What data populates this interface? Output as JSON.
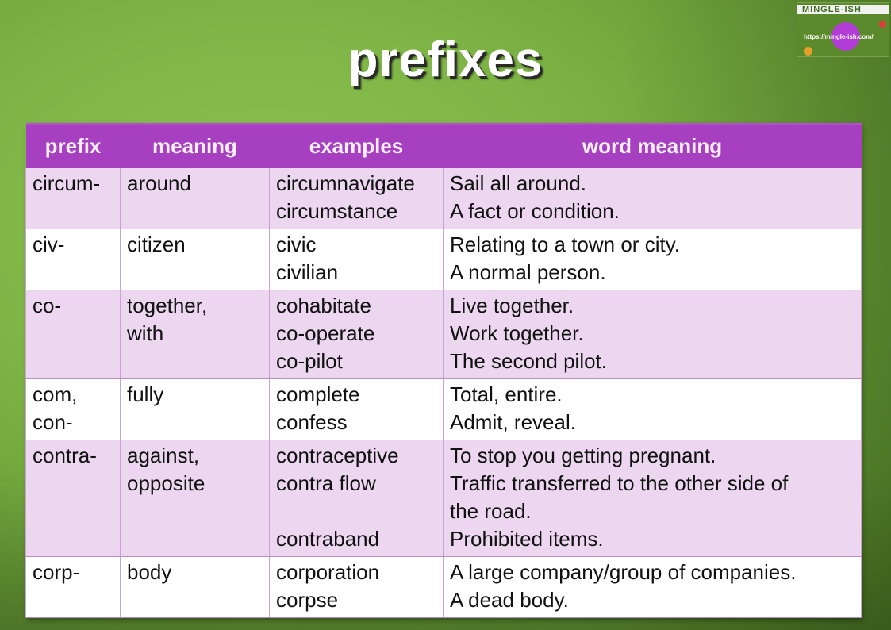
{
  "title": "prefixes",
  "logo": {
    "name": "MINGLE-ISH",
    "url": "https://mingle-ish.com/"
  },
  "colors": {
    "header_bg": "#a63fc0",
    "row_shaded": "#ecd6f0",
    "row_plain": "#ffffff",
    "background": "#7fb546"
  },
  "table": {
    "headers": [
      "prefix",
      "meaning",
      "examples",
      "word meaning"
    ],
    "rows": [
      {
        "prefix": [
          "circum-"
        ],
        "meaning": [
          "around"
        ],
        "examples": [
          "circumnavigate",
          "circumstance"
        ],
        "word_meaning": [
          "Sail all around.",
          "A fact or condition."
        ]
      },
      {
        "prefix": [
          "civ-"
        ],
        "meaning": [
          "citizen"
        ],
        "examples": [
          "civic",
          "civilian"
        ],
        "word_meaning": [
          "Relating to a town or city.",
          "A normal person."
        ]
      },
      {
        "prefix": [
          "co-"
        ],
        "meaning": [
          "together,",
          "with"
        ],
        "examples": [
          "cohabitate",
          "co-operate",
          "co-pilot"
        ],
        "word_meaning": [
          "Live together.",
          "Work together.",
          "The second pilot."
        ]
      },
      {
        "prefix": [
          "com,",
          "con-"
        ],
        "meaning": [
          "fully"
        ],
        "examples": [
          "complete",
          "confess"
        ],
        "word_meaning": [
          "Total, entire.",
          "Admit, reveal."
        ]
      },
      {
        "prefix": [
          "contra-"
        ],
        "meaning": [
          "against,",
          "opposite"
        ],
        "examples": [
          "contraceptive",
          "contra flow",
          "",
          "contraband"
        ],
        "word_meaning": [
          "To stop you getting pregnant.",
          "Traffic transferred to the other side of",
          "the road.",
          "Prohibited items."
        ]
      },
      {
        "prefix": [
          "corp-"
        ],
        "meaning": [
          "body"
        ],
        "examples": [
          "corporation",
          "corpse"
        ],
        "word_meaning": [
          "A large company/group of companies.",
          "A dead body."
        ]
      }
    ]
  }
}
